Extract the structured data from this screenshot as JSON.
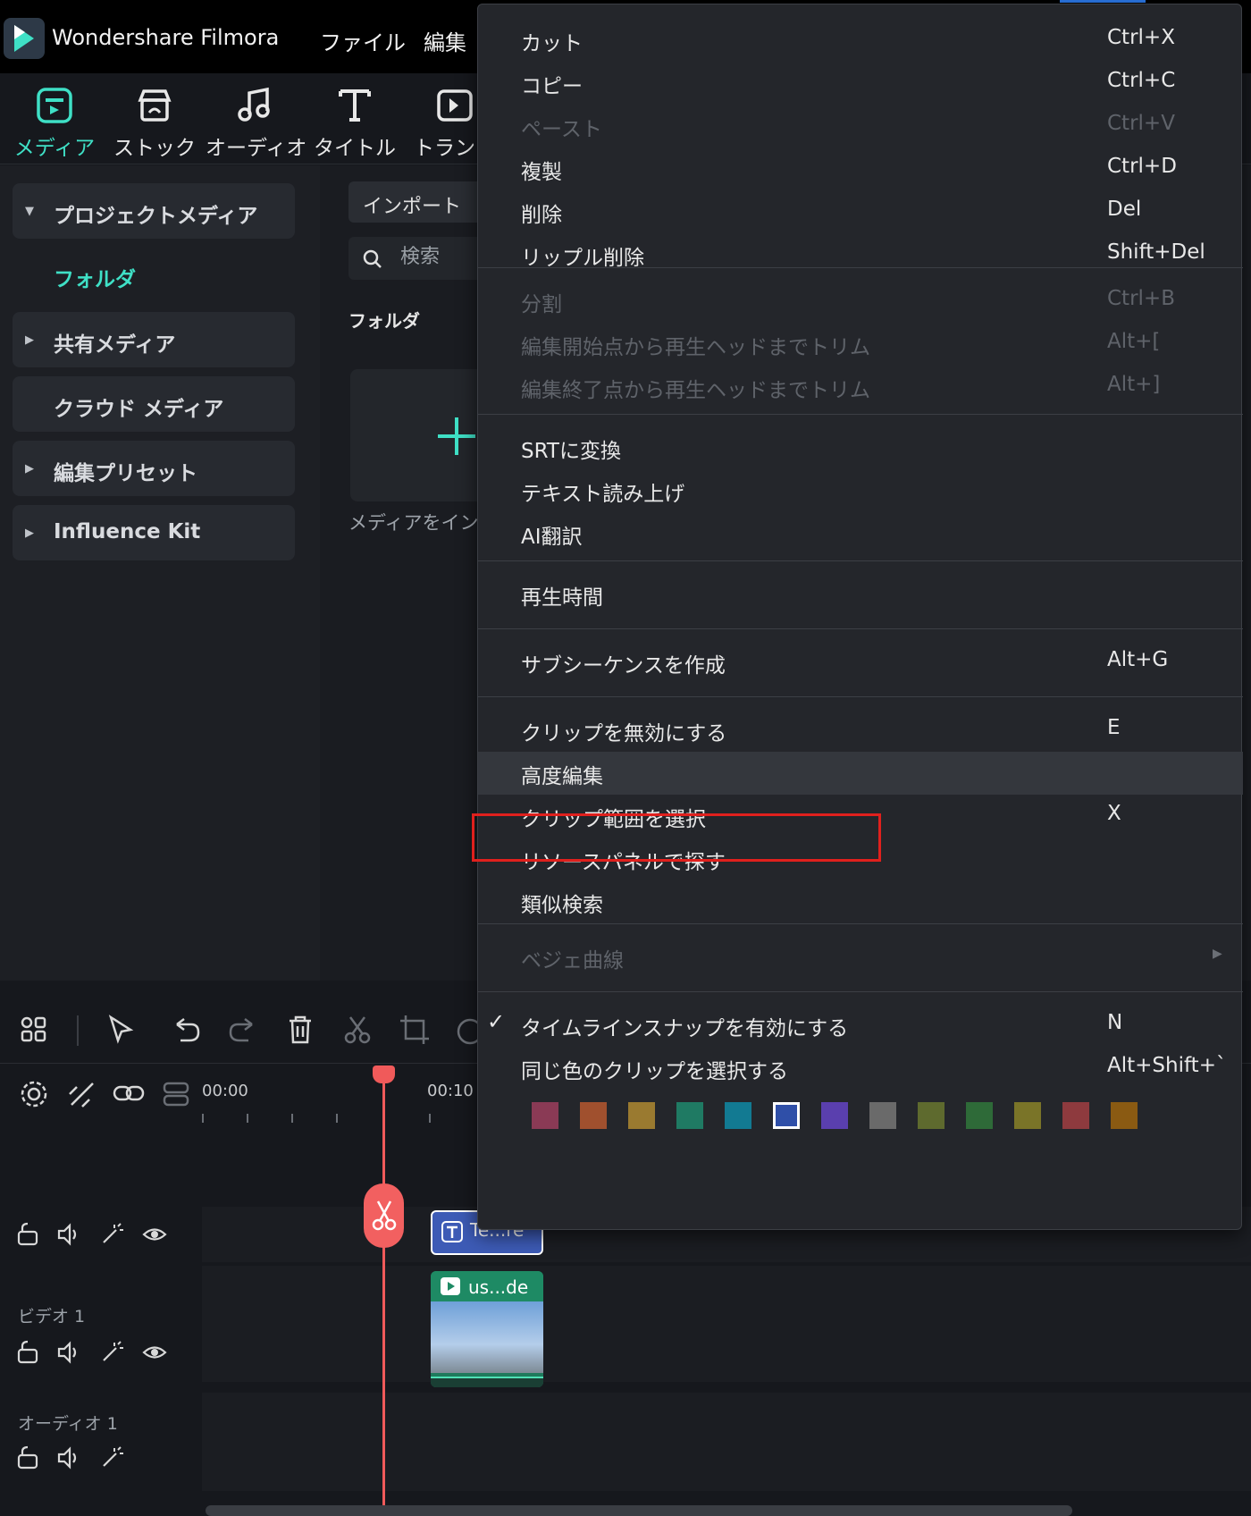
{
  "app": {
    "title": "Wondershare Filmora",
    "menus": [
      "ファイル",
      "編集"
    ]
  },
  "toolbar": {
    "tabs": [
      {
        "label": "メディア",
        "icon": "media-icon",
        "active": true
      },
      {
        "label": "ストック",
        "icon": "stock-icon",
        "active": false
      },
      {
        "label": "オーディオ",
        "icon": "audio-icon",
        "active": false
      },
      {
        "label": "タイトル",
        "icon": "title-icon",
        "active": false
      },
      {
        "label": "トランジ",
        "icon": "transition-icon",
        "active": false
      }
    ]
  },
  "sidebar": {
    "project_media": "プロジェクトメディア",
    "folder": "フォルダ",
    "shared_media": "共有メディア",
    "cloud_media": "クラウド メディア",
    "edit_presets": "編集プリセット",
    "influence_kit": "Influence Kit"
  },
  "media": {
    "import_label": "インポート",
    "search_placeholder": "検索",
    "folder_heading": "フォルダ",
    "import_caption": "メディアをインポ"
  },
  "timeline": {
    "ruler": [
      "00:00",
      "00:10"
    ],
    "tracks": [
      {
        "name": ""
      },
      {
        "name": "ビデオ 1"
      },
      {
        "name": "オーディオ 1"
      }
    ],
    "clip_title": "Te...re",
    "clip_video": "us...de"
  },
  "context_menu": {
    "groups": [
      [
        {
          "label": "カット",
          "shortcut": "Ctrl+X",
          "disabled": false
        },
        {
          "label": "コピー",
          "shortcut": "Ctrl+C",
          "disabled": false
        },
        {
          "label": "ペースト",
          "shortcut": "Ctrl+V",
          "disabled": true
        },
        {
          "label": "複製",
          "shortcut": "Ctrl+D",
          "disabled": false
        },
        {
          "label": "削除",
          "shortcut": "Del",
          "disabled": false
        },
        {
          "label": "リップル削除",
          "shortcut": "Shift+Del",
          "disabled": false
        }
      ],
      [
        {
          "label": "分割",
          "shortcut": "Ctrl+B",
          "disabled": true
        },
        {
          "label": "編集開始点から再生ヘッドまでトリム",
          "shortcut": "Alt+[",
          "disabled": true
        },
        {
          "label": "編集終了点から再生ヘッドまでトリム",
          "shortcut": "Alt+]",
          "disabled": true
        }
      ],
      [
        {
          "label": "SRTに変換",
          "shortcut": "",
          "disabled": false
        },
        {
          "label": "テキスト読み上げ",
          "shortcut": "",
          "disabled": false
        },
        {
          "label": "AI翻訳",
          "shortcut": "",
          "disabled": false
        }
      ],
      [
        {
          "label": "再生時間",
          "shortcut": "",
          "disabled": false
        }
      ],
      [
        {
          "label": "サブシーケンスを作成",
          "shortcut": "Alt+G",
          "disabled": false
        }
      ],
      [
        {
          "label": "クリップを無効にする",
          "shortcut": "E",
          "disabled": false
        },
        {
          "label": "高度編集",
          "shortcut": "",
          "disabled": false,
          "highlighted": true
        },
        {
          "label": "クリップ範囲を選択",
          "shortcut": "X",
          "disabled": false
        },
        {
          "label": "リソースパネルで探す",
          "shortcut": "",
          "disabled": false
        },
        {
          "label": "類似検索",
          "shortcut": "",
          "disabled": false
        }
      ],
      [
        {
          "label": "ベジェ曲線",
          "shortcut": "",
          "disabled": true,
          "submenu": true
        }
      ],
      [
        {
          "label": "タイムラインスナップを有効にする",
          "shortcut": "N",
          "disabled": false,
          "checked": true
        },
        {
          "label": "同じ色のクリップを選択する",
          "shortcut": "Alt+Shift+`",
          "disabled": false
        }
      ]
    ],
    "swatches": [
      "#8a3a55",
      "#a0502e",
      "#9a7a30",
      "#1f7a63",
      "#127a92",
      "#2f4fa8",
      "#5a3fae",
      "#6a6a6a",
      "#5e6a2e",
      "#2e6a38",
      "#7a7428",
      "#8e3a3e",
      "#8a5a12"
    ],
    "selected_swatch": 5
  },
  "colors": {
    "accent": "#3fe0c6",
    "playhead": "#f05a5a",
    "highlight_box": "#e0201d"
  }
}
